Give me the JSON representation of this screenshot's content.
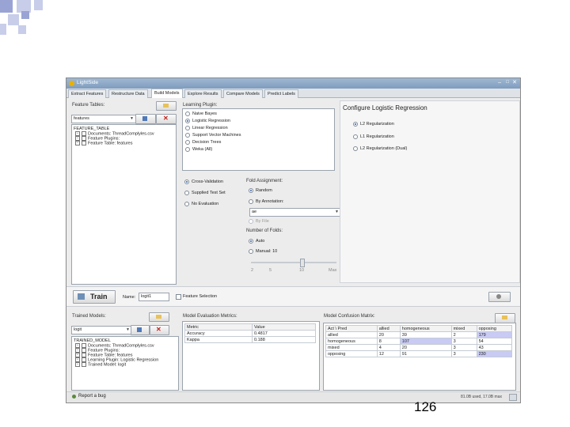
{
  "colors": {
    "square_dark": "#9aa4d4",
    "square_light": "#c8cde9",
    "titlebar": "#88a4c4",
    "highlight_row": "#c9cbf5"
  },
  "window": {
    "title": "LightSide"
  },
  "tabs": [
    {
      "label": "Extract Features"
    },
    {
      "label": "Restructure Data"
    },
    {
      "label": "Build Models"
    },
    {
      "label": "Explore Results"
    },
    {
      "label": "Compare Models"
    },
    {
      "label": "Predict Labels"
    }
  ],
  "feature_tables": {
    "label": "Feature Tables:",
    "selected": "features",
    "tree": [
      "FEATURE_TABLE",
      "Documents: ThreadComplyles.csv",
      "Feature Plugins:",
      "Feature Table: features"
    ]
  },
  "learning_plugin": {
    "label": "Learning Plugin:",
    "options": [
      {
        "label": "Naive Bayes",
        "selected": false
      },
      {
        "label": "Logistic Regression",
        "selected": true
      },
      {
        "label": "Linear Regression",
        "selected": false
      },
      {
        "label": "Support Vector Machines",
        "selected": false
      },
      {
        "label": "Decision Trees",
        "selected": false
      },
      {
        "label": "Weka (All)",
        "selected": false
      }
    ]
  },
  "evaluation": {
    "options": [
      {
        "label": "Cross-Validation",
        "selected": true
      },
      {
        "label": "Supplied Test Set",
        "selected": false
      },
      {
        "label": "No Evaluation",
        "selected": false
      }
    ],
    "fold_assignment_label": "Fold Assignment:",
    "fold_options": [
      {
        "label": "Random",
        "selected": true
      },
      {
        "label": "By Annotation:",
        "selected": false
      }
    ],
    "annotation_select": "ae",
    "by_file_label": "By File",
    "num_folds_label": "Number of Folds:",
    "num_folds_options": [
      {
        "label": "Auto",
        "selected": true
      },
      {
        "label": "Manual: 10",
        "selected": false
      }
    ],
    "slider_ticks": [
      "2",
      "5",
      "10",
      "Max"
    ],
    "slider_value": 10
  },
  "configure": {
    "title": "Configure Logistic Regression",
    "options": [
      {
        "label": "L2 Regularization",
        "selected": true
      },
      {
        "label": "L1 Regularization",
        "selected": false
      },
      {
        "label": "L2 Regularization (Dual)",
        "selected": false
      }
    ]
  },
  "train_bar": {
    "train_label": "Train",
    "name_label": "Name:",
    "name_value": "logit1",
    "feature_selection_label": "Feature Selection"
  },
  "trained_models": {
    "label": "Trained Models:",
    "selected": "logit",
    "tree": [
      "TRAINED_MODEL",
      "Documents: ThreadComplyles.csv",
      "Feature Plugins:",
      "Feature Table: features",
      "Learning Plugin: Logistic Regression",
      "Trained Model: logit"
    ]
  },
  "evaluation_metrics": {
    "label": "Model Evaluation Metrics:",
    "headers": [
      "Metric",
      "Value"
    ],
    "rows": [
      [
        "Accuracy",
        "0.4817"
      ],
      [
        "Kappa",
        "0.188"
      ]
    ]
  },
  "confusion_matrix": {
    "label": "Model Confusion Matrix:",
    "headers": [
      "Act \\ Pred",
      "allied",
      "homogeneous",
      "mixed",
      "opposing"
    ],
    "rows": [
      [
        "allied",
        "20",
        "39",
        "2",
        "179"
      ],
      [
        "homogeneous",
        "8",
        "107",
        "3",
        "54"
      ],
      [
        "mixed",
        "4",
        "20",
        "3",
        "43"
      ],
      [
        "opposing",
        "12",
        "91",
        "3",
        "230"
      ]
    ]
  },
  "status_bar": {
    "report_bug": "Report a bug",
    "memory": "81.0B used, 17.0B max"
  },
  "slide_number": "126"
}
